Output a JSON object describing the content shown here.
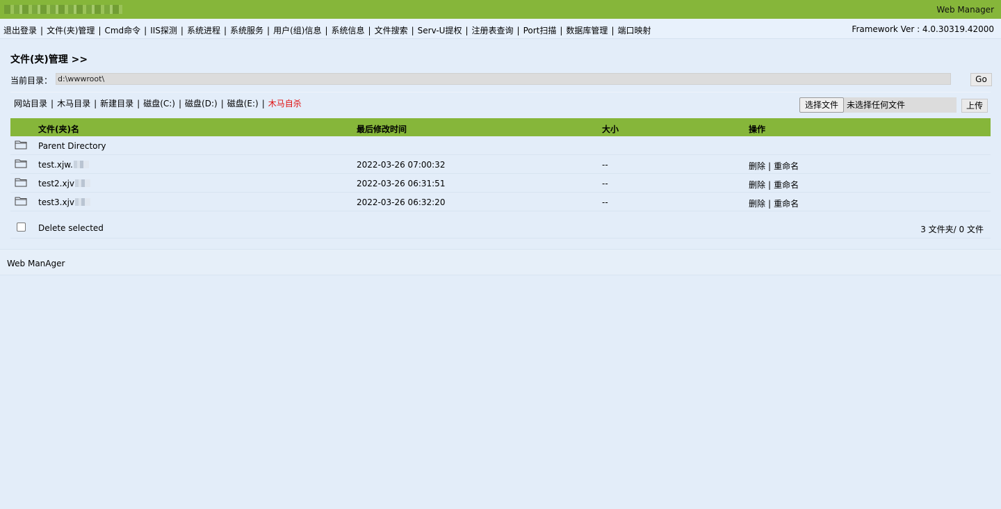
{
  "header": {
    "brand": "Web Manager"
  },
  "nav": {
    "items": [
      "退出登录",
      "文件(夹)管理",
      "Cmd命令",
      "IIS探测",
      "系统进程",
      "系统服务",
      "用户(组)信息",
      "系统信息",
      "文件搜索",
      "Serv-U提权",
      "注册表查询",
      "Port扫描",
      "数据库管理",
      "端口映射"
    ],
    "framework": "Framework Ver : 4.0.30319.42000"
  },
  "page": {
    "title": "文件(夹)管理 >>"
  },
  "directory": {
    "label": "当前目录：",
    "value": "d:\\wwwroot\\",
    "go_label": "Go"
  },
  "dir_links": [
    "网站目录",
    "木马目录",
    "新建目录",
    "磁盘(C:)",
    "磁盘(D:)",
    "磁盘(E:)",
    "木马自杀"
  ],
  "upload": {
    "choose_label": "选择文件",
    "status": "未选择任何文件",
    "upload_label": "上传"
  },
  "table": {
    "headers": [
      "文件(夹)名",
      "最后修改时间",
      "大小",
      "操作"
    ],
    "parent_label": "Parent Directory",
    "rows": [
      {
        "name": "test.xjw.",
        "time": "2022-03-26 07:00:32",
        "size": "--",
        "delete": "删除",
        "rename": "重命名"
      },
      {
        "name": "test2.xjv",
        "time": "2022-03-26 06:31:51",
        "size": "--",
        "delete": "删除",
        "rename": "重命名"
      },
      {
        "name": "test3.xjv",
        "time": "2022-03-26 06:32:20",
        "size": "--",
        "delete": "删除",
        "rename": "重命名"
      }
    ],
    "delete_selected": "Delete selected",
    "summary": "3 文件夹/ 0 文件"
  },
  "footer": {
    "text": "Web ManAger"
  },
  "colors": {
    "accent": "#86b63a",
    "background": "#e3edf9",
    "danger": "#e01010"
  },
  "icons": {
    "folder": "folder-icon"
  }
}
